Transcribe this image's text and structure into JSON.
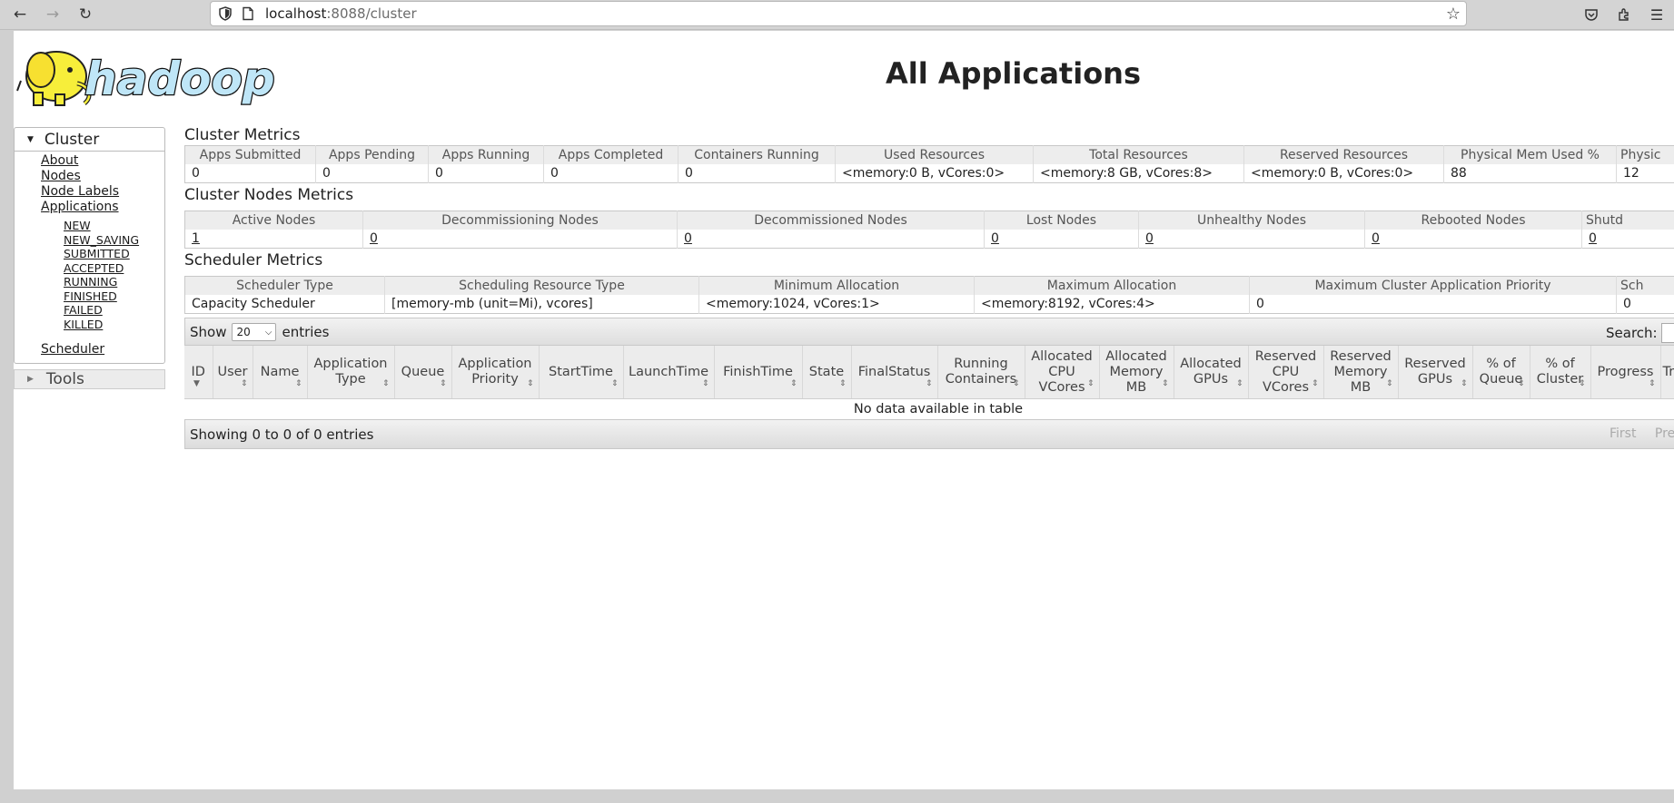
{
  "browser": {
    "url_host": "localhost",
    "url_rest": ":8088/cluster"
  },
  "page": {
    "title": "All Applications",
    "logo_text": "hadoop"
  },
  "sidebar": {
    "cluster_label": "Cluster",
    "links": [
      "About",
      "Nodes",
      "Node Labels",
      "Applications"
    ],
    "app_states": [
      "NEW",
      "NEW_SAVING",
      "SUBMITTED",
      "ACCEPTED",
      "RUNNING",
      "FINISHED",
      "FAILED",
      "KILLED"
    ],
    "scheduler_link": "Scheduler",
    "tools_label": "Tools"
  },
  "cluster_metrics": {
    "title": "Cluster Metrics",
    "headers": [
      "Apps Submitted",
      "Apps Pending",
      "Apps Running",
      "Apps Completed",
      "Containers Running",
      "Used Resources",
      "Total Resources",
      "Reserved Resources",
      "Physical Mem Used %",
      "Physic"
    ],
    "values": [
      "0",
      "0",
      "0",
      "0",
      "0",
      "<memory:0 B, vCores:0>",
      "<memory:8 GB, vCores:8>",
      "<memory:0 B, vCores:0>",
      "88",
      "12"
    ]
  },
  "nodes_metrics": {
    "title": "Cluster Nodes Metrics",
    "headers": [
      "Active Nodes",
      "Decommissioning Nodes",
      "Decommissioned Nodes",
      "Lost Nodes",
      "Unhealthy Nodes",
      "Rebooted Nodes",
      "Shutd"
    ],
    "values": [
      "1",
      "0",
      "0",
      "0",
      "0",
      "0",
      "0"
    ]
  },
  "scheduler_metrics": {
    "title": "Scheduler Metrics",
    "headers": [
      "Scheduler Type",
      "Scheduling Resource Type",
      "Minimum Allocation",
      "Maximum Allocation",
      "Maximum Cluster Application Priority",
      "Sch"
    ],
    "values": [
      "Capacity Scheduler",
      "[memory-mb (unit=Mi), vcores]",
      "<memory:1024, vCores:1>",
      "<memory:8192, vCores:4>",
      "0",
      "0"
    ]
  },
  "apps_table": {
    "show_label": "Show",
    "entries_label": "entries",
    "page_size": "20",
    "search_label": "Search:",
    "columns": [
      "ID",
      "User",
      "Name",
      "Application Type",
      "Queue",
      "Application Priority",
      "StartTime",
      "LaunchTime",
      "FinishTime",
      "State",
      "FinalStatus",
      "Running Containers",
      "Allocated CPU VCores",
      "Allocated Memory MB",
      "Allocated GPUs",
      "Reserved CPU VCores",
      "Reserved Memory MB",
      "Reserved GPUs",
      "% of Queue",
      "% of Cluster",
      "Progress",
      "Tra"
    ],
    "empty_text": "No data available in table",
    "info_text": "Showing 0 to 0 of 0 entries",
    "pager": [
      "First",
      "Pre"
    ]
  }
}
